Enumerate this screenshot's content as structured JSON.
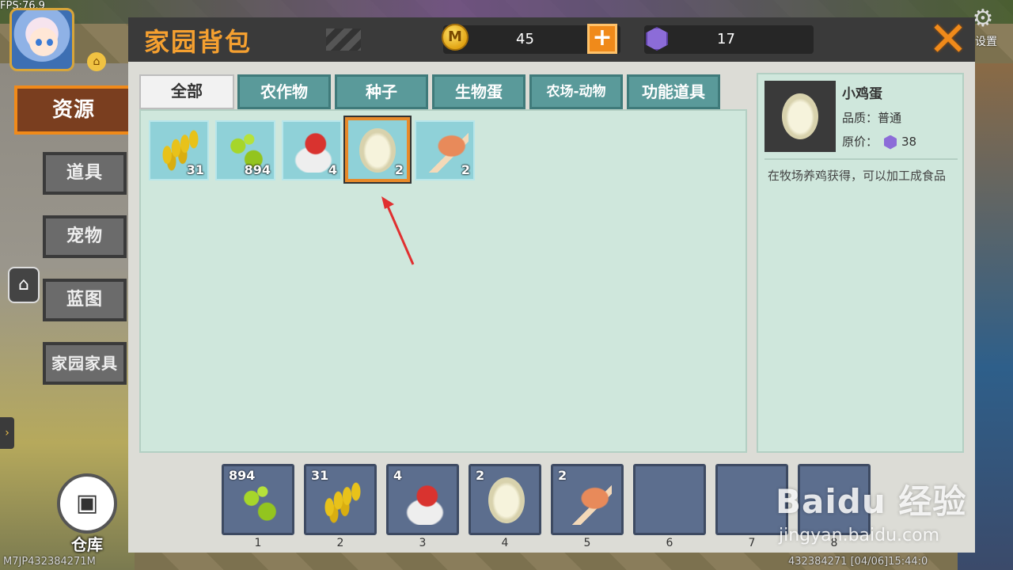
{
  "hud": {
    "fps": "FPS:76.9",
    "settings_label": "设置",
    "storage_label": "仓库",
    "bottom_id": "M7JP432384271M",
    "bottom_right": "432384271  [04/06]15:44:0"
  },
  "categories": [
    {
      "label": "资源",
      "active": true
    },
    {
      "label": "道具",
      "active": false
    },
    {
      "label": "宠物",
      "active": false
    },
    {
      "label": "蓝图",
      "active": false
    },
    {
      "label": "家园家具",
      "active": false
    }
  ],
  "window": {
    "title": "家园背包",
    "coins": "45",
    "gems": "17",
    "coin_symbol": "M",
    "plus_symbol": "+",
    "close_symbol": "✕"
  },
  "tabs": [
    {
      "label": "全部",
      "active": true
    },
    {
      "label": "农作物",
      "active": false
    },
    {
      "label": "种子",
      "active": false
    },
    {
      "label": "生物蛋",
      "active": false
    },
    {
      "label": "农场-动物",
      "active": false
    },
    {
      "label": "功能道具",
      "active": false
    }
  ],
  "items": [
    {
      "icon": "wheat-icon",
      "count": "31"
    },
    {
      "icon": "seeds-icon",
      "count": "894"
    },
    {
      "icon": "chick-egg-icon",
      "count": "4"
    },
    {
      "icon": "egg-icon",
      "count": "2",
      "selected": true
    },
    {
      "icon": "ham-icon",
      "count": "2"
    }
  ],
  "detail": {
    "name": "小鸡蛋",
    "quality_label": "品质：",
    "quality_value": "普通",
    "price_label": "原价：",
    "price_value": "38",
    "description": "在牧场养鸡获得，可以加工成食品"
  },
  "hotbar": [
    {
      "icon": "seeds-icon",
      "count": "894",
      "index": "1"
    },
    {
      "icon": "wheat-icon",
      "count": "31",
      "index": "2"
    },
    {
      "icon": "chick-egg-icon",
      "count": "4",
      "index": "3"
    },
    {
      "icon": "egg-icon",
      "count": "2",
      "index": "4"
    },
    {
      "icon": "ham-icon",
      "count": "2",
      "index": "5"
    },
    {
      "icon": "",
      "count": "",
      "index": "6"
    },
    {
      "icon": "",
      "count": "",
      "index": "7"
    },
    {
      "icon": "",
      "count": "",
      "index": "8"
    }
  ],
  "watermark": {
    "text": "Baidu 经验",
    "url": "jingyan.baidu.com"
  },
  "colors": {
    "accent": "#f08a1a",
    "tab": "#5a9a9a",
    "panel": "#cfe7dc",
    "slot": "#8fd1d8",
    "hotbar_slot": "#5c6e8e"
  }
}
